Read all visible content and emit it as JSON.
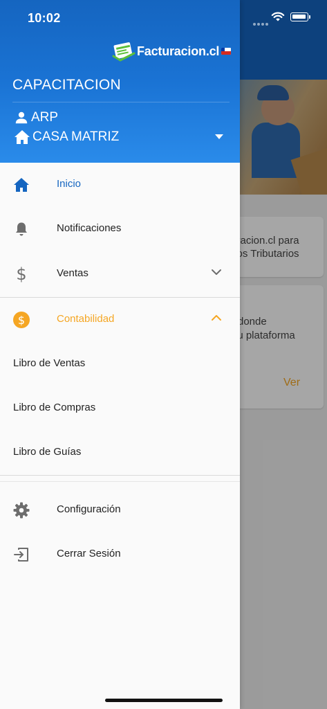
{
  "status_bar": {
    "time": "10:02"
  },
  "drawer": {
    "logo_text": "Facturacion.cl",
    "company": "CAPACITACION",
    "user": "ARP",
    "branch": "CASA MATRIZ"
  },
  "menu": {
    "inicio": "Inicio",
    "notificaciones": "Notificaciones",
    "ventas": "Ventas",
    "contabilidad": "Contabilidad",
    "libro_ventas": "Libro de Ventas",
    "libro_compras": "Libro de Compras",
    "libro_guias": "Libro de Guías",
    "configuracion": "Configuración",
    "cerrar_sesion": "Cerrar Sesión"
  },
  "background": {
    "card1_line1": "turacion.cl para",
    "card1_line2": "ntos Tributarios",
    "card2_line1": "donde",
    "card2_line2": "r tu plataforma",
    "card2_action": "Ver"
  },
  "colors": {
    "header_blue": "#1565c0",
    "active_blue": "#1565c0",
    "contabilidad_orange": "#f5a623",
    "icon_gray": "#6d6d6d"
  },
  "icons": {
    "inicio": "home-icon",
    "notificaciones": "bell-icon",
    "ventas": "dollar-icon",
    "contabilidad": "coin-icon",
    "configuracion": "gear-icon",
    "cerrar_sesion": "logout-icon"
  }
}
